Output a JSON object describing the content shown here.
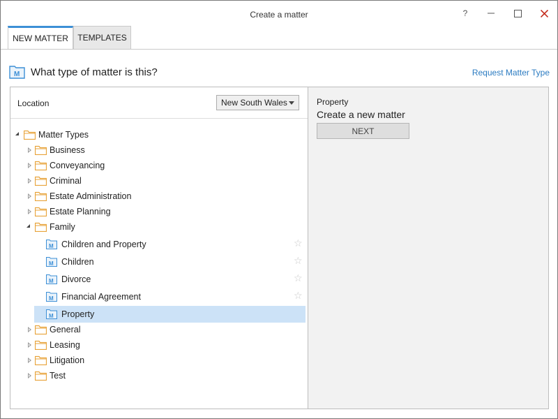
{
  "window": {
    "title": "Create a matter",
    "help_label": "?"
  },
  "tabs": [
    {
      "label": "NEW MATTER"
    },
    {
      "label": "TEMPLATES"
    }
  ],
  "header": {
    "question": "What type of matter is this?",
    "request_link": "Request Matter Type"
  },
  "location": {
    "label": "Location",
    "selected": "New South Wales"
  },
  "tree": {
    "root": "Matter Types",
    "folders": [
      {
        "label": "Business"
      },
      {
        "label": "Conveyancing"
      },
      {
        "label": "Criminal"
      },
      {
        "label": "Estate Administration"
      },
      {
        "label": "Estate Planning"
      },
      {
        "label": "Family"
      },
      {
        "label": "General"
      },
      {
        "label": "Leasing"
      },
      {
        "label": "Litigation"
      },
      {
        "label": "Test"
      }
    ],
    "family_items": [
      {
        "label": "Children and Property"
      },
      {
        "label": "Children"
      },
      {
        "label": "Divorce"
      },
      {
        "label": "Financial Agreement"
      },
      {
        "label": "Property"
      }
    ],
    "selected": "Property"
  },
  "details": {
    "subtitle": "Property",
    "title": "Create a new matter",
    "next_label": "NEXT"
  },
  "colors": {
    "accent": "#3c8fd6",
    "selection": "#cce2f7",
    "folder": "#e8a33a",
    "link": "#2b7bc1"
  }
}
